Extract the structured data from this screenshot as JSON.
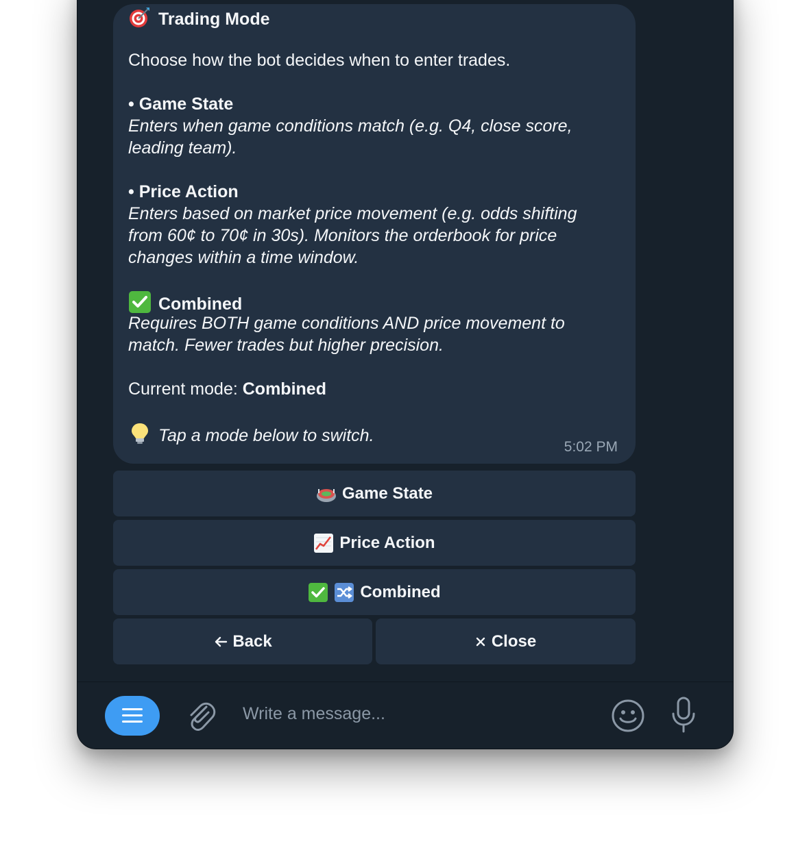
{
  "message": {
    "title": "Trading Mode",
    "title_icon": "direct-hit-dart-icon",
    "intro": "Choose how the bot decides when to enter trades.",
    "modes": [
      {
        "bullet": "•",
        "name": "Game State",
        "desc_lines": [
          "Enters when game conditions match (e.g. Q4, close score,",
          "leading team)."
        ]
      },
      {
        "bullet": "•",
        "name": "Price Action",
        "desc_lines": [
          "Enters based on market price movement (e.g. odds shifting",
          "from 60¢ to 70¢ in 30s). Monitors the orderbook for price",
          "changes within a time window."
        ]
      },
      {
        "bullet_icon": "green-check-icon",
        "name": "Combined",
        "desc_lines": [
          "Requires BOTH game conditions AND price movement to",
          "match. Fewer trades but higher precision."
        ]
      }
    ],
    "current_mode_label": "Current mode: ",
    "current_mode_value": "Combined",
    "hint_icon": "lightbulb-icon",
    "hint": "Tap a mode below to switch.",
    "timestamp": "5:02 PM"
  },
  "keyboard": {
    "game_state": {
      "label": "Game State",
      "icon": "stadium-icon"
    },
    "price_action": {
      "label": "Price Action",
      "icon": "chart-increasing-icon"
    },
    "combined": {
      "label": "Combined",
      "icons": [
        "green-check-icon",
        "shuffle-icon"
      ]
    },
    "back": {
      "label": "Back",
      "icon": "arrow-left-icon"
    },
    "close": {
      "label": "Close",
      "icon": "multiply-icon"
    }
  },
  "composer": {
    "placeholder": "Write a message...",
    "menu_icon": "hamburger-menu-icon",
    "attach_icon": "paperclip-icon",
    "emoji_icon": "smiley-icon",
    "mic_icon": "microphone-icon"
  },
  "colors": {
    "window_bg": "#17212b",
    "bubble_bg": "#233142",
    "accent": "#3e9cf3",
    "text": "#f4f6f8",
    "muted": "#8b98a6"
  }
}
